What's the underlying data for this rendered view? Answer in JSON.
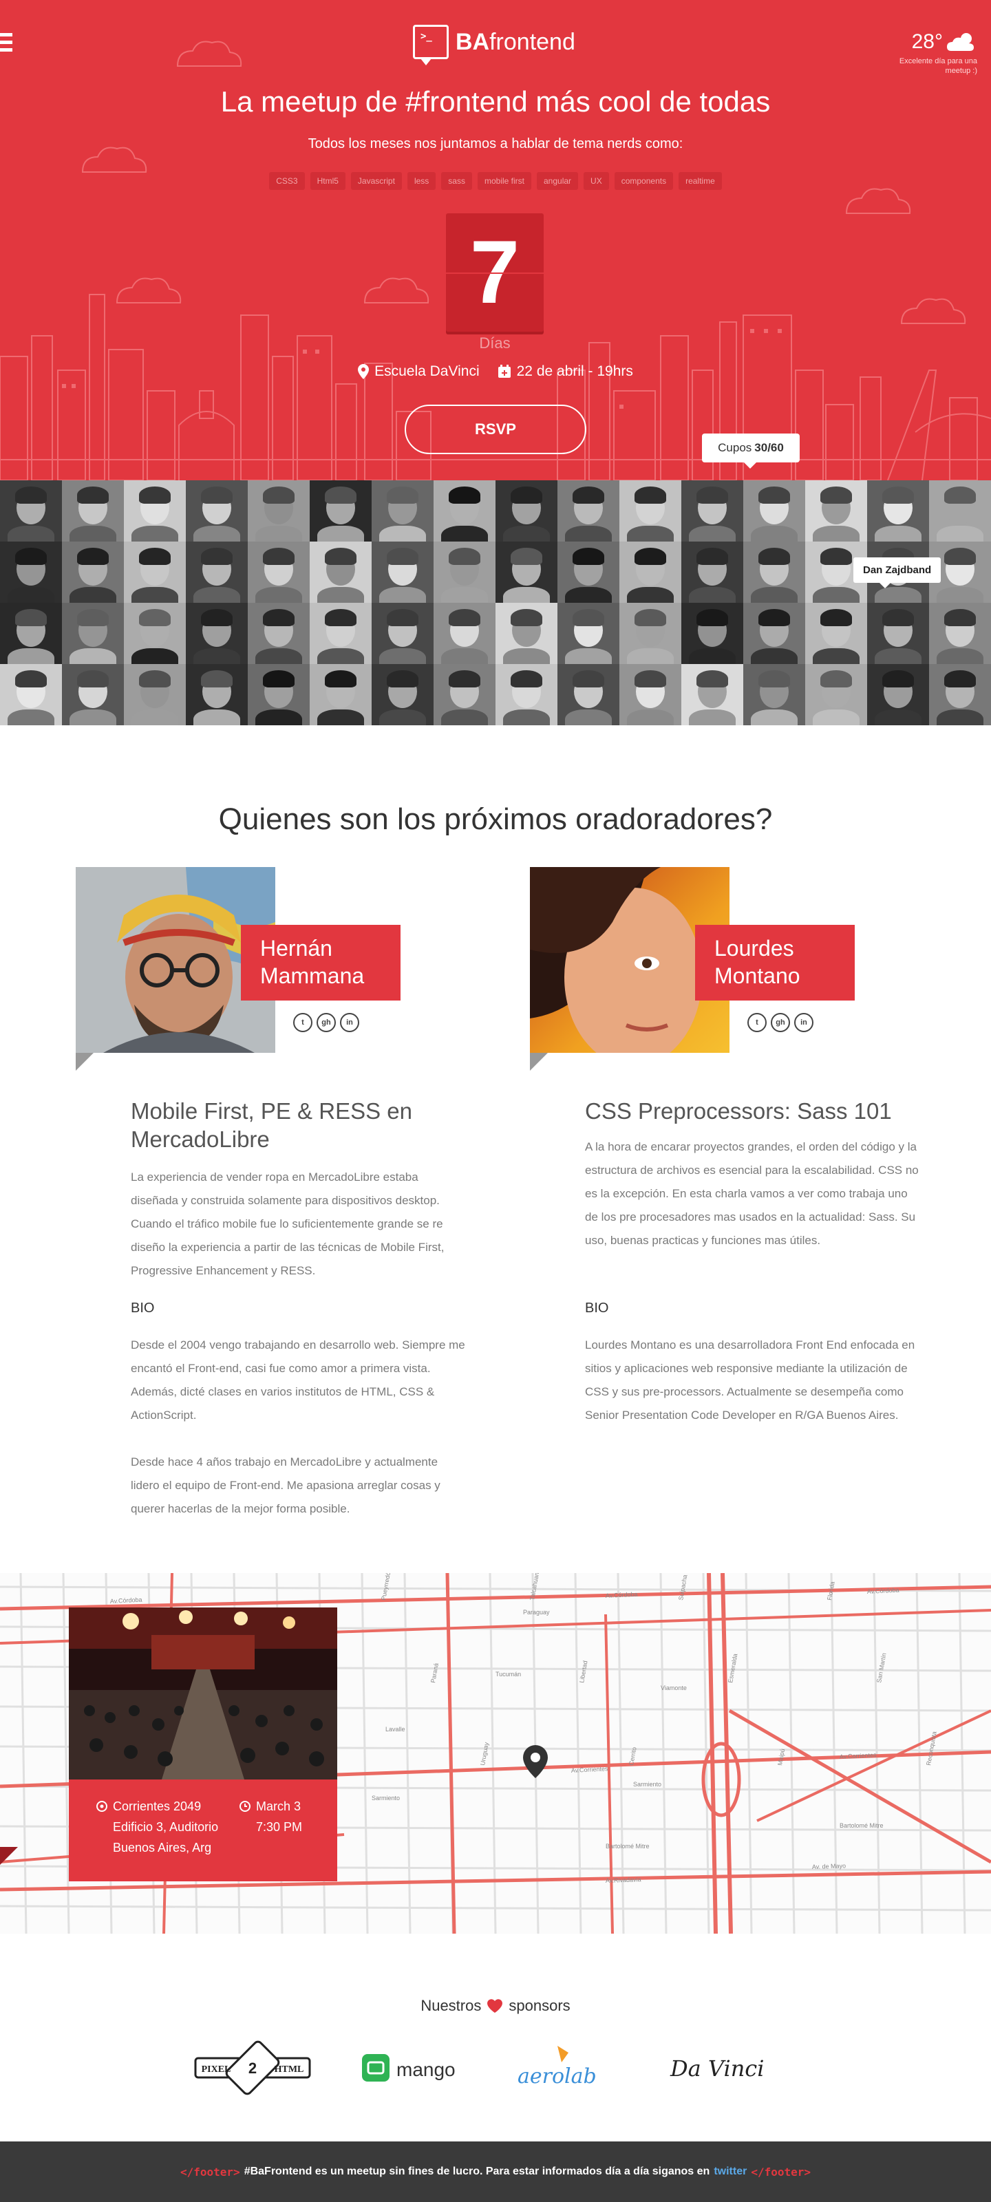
{
  "header": {
    "logo_prompt": ">_",
    "logo_bold": "BA",
    "logo_rest": "frontend",
    "weather_temp": "28°",
    "weather_msg": "Excelente día para una meetup :)",
    "weather_icon": "cloud-sun-icon"
  },
  "hero": {
    "title": "La meetup de #frontend más cool de todas",
    "subtitle": "Todos los meses nos juntamos a hablar de tema nerds como:",
    "tags": [
      "CSS3",
      "Html5",
      "Javascript",
      "less",
      "sass",
      "mobile first",
      "angular",
      "UX",
      "components",
      "realtime"
    ],
    "countdown_number": "7",
    "countdown_label": "Días",
    "location": "Escuela DaVinci",
    "date": "22 de abril - 19hrs",
    "rsvp_label": "RSVP",
    "cupos_label": "Cupos",
    "cupos_value": "30/60",
    "accent": "#e2373f"
  },
  "attendees": {
    "tooltip_name": "Dan Zajdband",
    "count": 64
  },
  "speakers_section": {
    "title": "Quienes son los próximos oradoradores?",
    "speakers": [
      {
        "name_line1": "Hernán",
        "name_line2": "Mammana",
        "talk_title": "Mobile First, PE & RESS en MercadoLibre",
        "description": "La experiencia de vender ropa en MercadoLibre estaba diseñada y construida solamente para dispositivos desktop. Cuando el tráfico mobile fue lo suficientemente grande se re diseño la experiencia a partir de las técnicas de Mobile First, Progressive Enhancement y RESS.",
        "bio_title": "BIO",
        "bio_p1": "Desde el 2004 vengo trabajando en desarrollo web. Siempre me encantó el Front-end, casi fue como amor a primera vista. Además, dicté clases en varios institutos de HTML, CSS & ActionScript.",
        "bio_p2": "Desde hace 4 años trabajo en MercadoLibre y actualmente lidero el equipo de Front-end. Me apasiona arreglar cosas y querer hacerlas de la mejor forma posible."
      },
      {
        "name_line1": "Lourdes",
        "name_line2": "Montano",
        "talk_title": "CSS Preprocessors: Sass 101",
        "description": "A la hora de encarar proyectos grandes, el orden del código y la estructura de archivos es esencial para la escalabilidad. CSS no es la excepción. En esta charla vamos a ver como trabaja uno de los pre procesadores mas usados en la actualidad: Sass. Su uso, buenas practicas y funciones mas útiles.",
        "bio_title": "BIO",
        "bio_p1": "Lourdes Montano es una desarrolladora Front End enfocada en sitios y aplicaciones web responsive mediante la utilización de CSS y sus pre-processors. Actualmente se desempeña como Senior Presentation Code Developer en R/GA Buenos Aires.",
        "bio_p2": ""
      }
    ],
    "social_icons": [
      "twitter-icon",
      "github-icon",
      "linkedin-icon"
    ]
  },
  "venue": {
    "address_line1": "Corrientes 2049",
    "address_line2": "Edificio 3, Auditorio",
    "address_line3": "Buenos Aires, Arg",
    "date_line1": "March 3",
    "date_line2": "7:30 PM"
  },
  "map_streets": {
    "h": [
      "Av.Córdoba",
      "Tucumán",
      "Lavalle",
      "Av.Corrientes",
      "Sarmiento",
      "Bartolomé Mitre",
      "Av.Rivadavia",
      "Paraguay",
      "Viamonte",
      "Av. de Mayo"
    ],
    "v": [
      "Pueyrredón",
      "Paraná",
      "Uruguay",
      "Talcahuano",
      "Libertad",
      "Cerrito",
      "Suipacha",
      "Esmeralda",
      "Maipú",
      "Florida",
      "San Martín",
      "Reconquista"
    ]
  },
  "sponsors": {
    "title_pre": "Nuestros",
    "title_post": "sponsors",
    "items": [
      {
        "label": "PIXEL",
        "label2": "HTML"
      },
      {
        "label": "mango"
      },
      {
        "label": "aerolab"
      },
      {
        "label": "Da Vinci"
      }
    ]
  },
  "footer": {
    "open_tag": "</footer>",
    "text": "#BaFrontend es un meetup sin fines de lucro. Para estar informados día a día siganos en",
    "link": "twitter",
    "close_tag": "</footer>"
  }
}
